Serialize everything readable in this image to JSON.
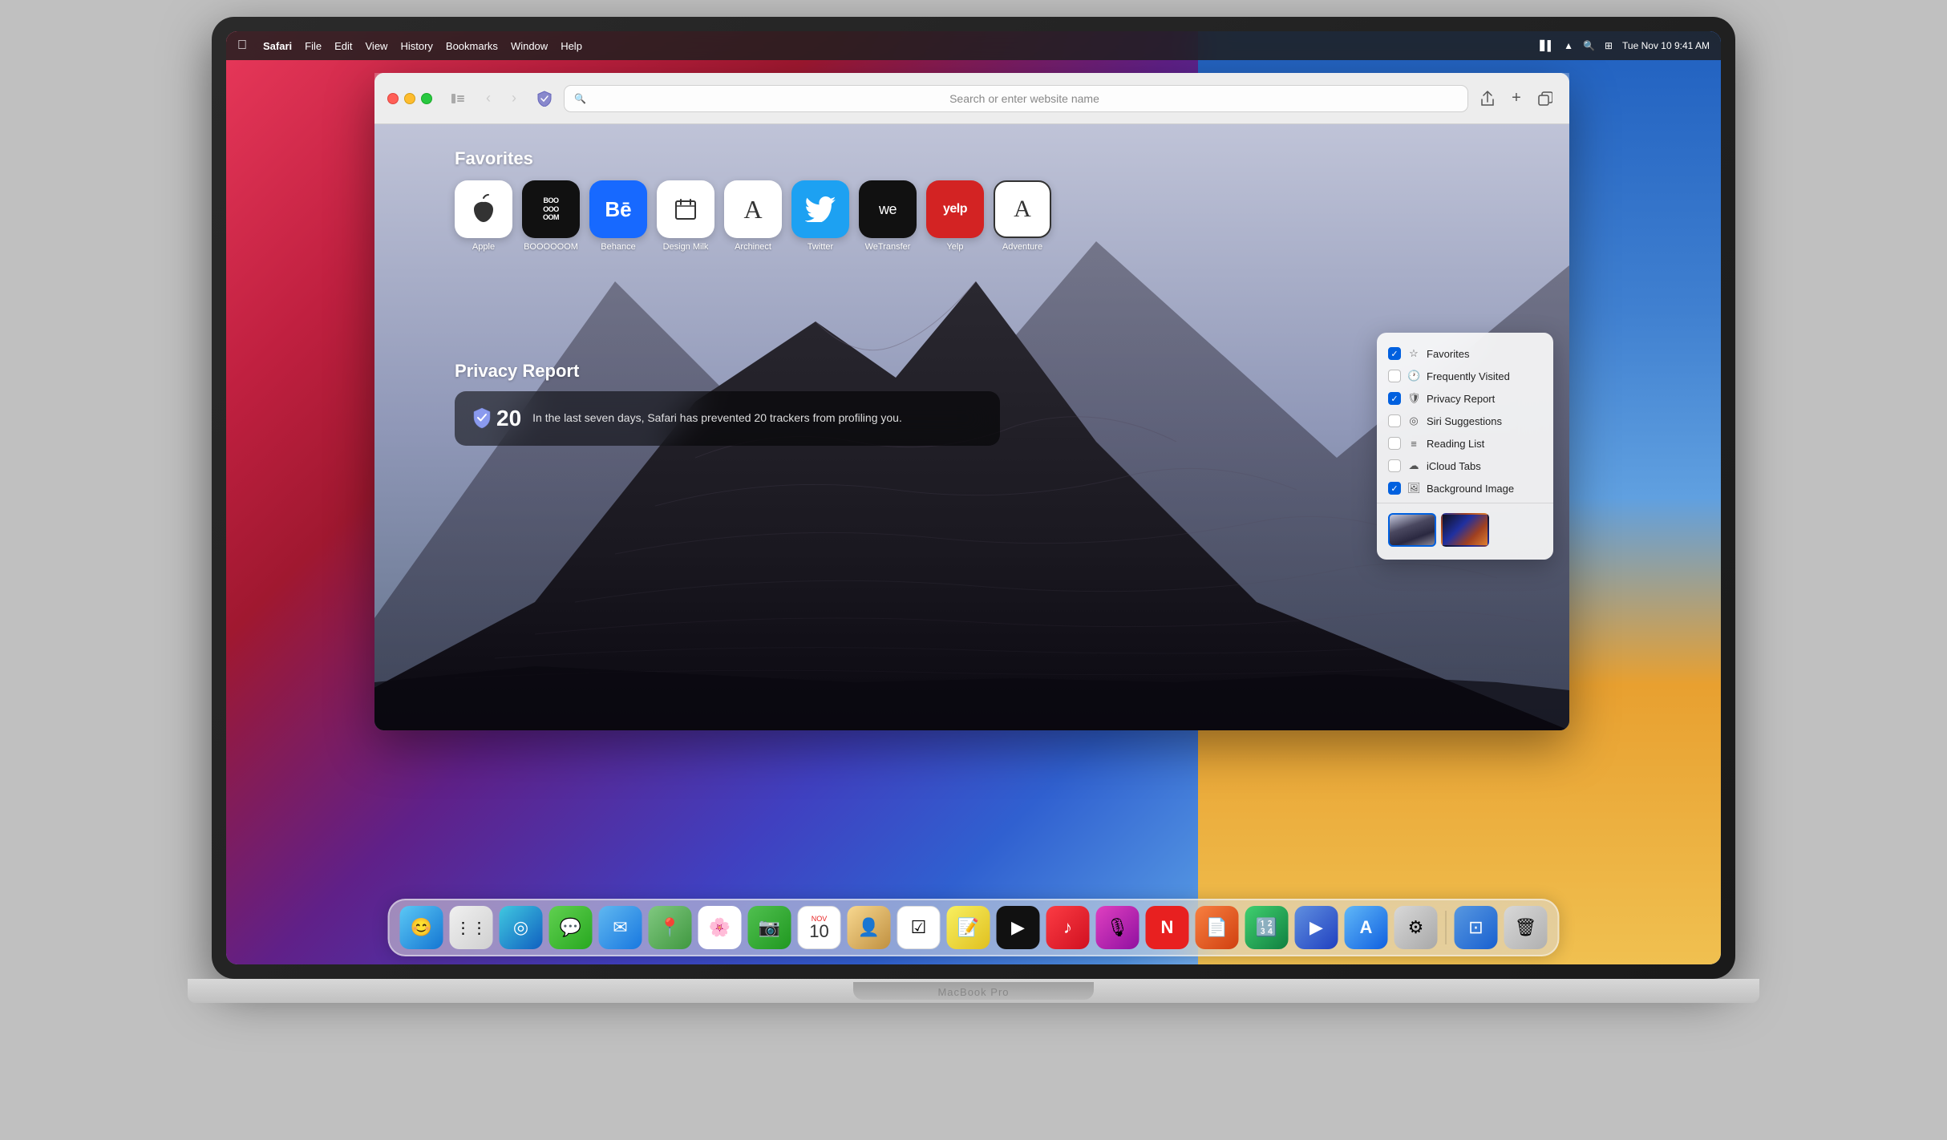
{
  "menubar": {
    "apple_label": "",
    "app_name": "Safari",
    "menus": [
      "File",
      "Edit",
      "View",
      "History",
      "Bookmarks",
      "Window",
      "Help"
    ],
    "time": "Tue Nov 10  9:41 AM"
  },
  "safari": {
    "address_placeholder": "Search or enter website name",
    "toolbar_buttons": {
      "share": "⬆",
      "new_tab": "+",
      "tabs": "⧉"
    }
  },
  "favorites": {
    "title": "Favorites",
    "items": [
      {
        "label": "Apple",
        "bg": "apple",
        "symbol": ""
      },
      {
        "label": "BOOOOOOM",
        "bg": "boooooom",
        "symbol": "BOO\nOOO\nOOM"
      },
      {
        "label": "Behance",
        "bg": "behance",
        "symbol": "Bē"
      },
      {
        "label": "Design Milk",
        "bg": "designmilk",
        "symbol": "🥛"
      },
      {
        "label": "Archinect",
        "bg": "archinect",
        "symbol": "A"
      },
      {
        "label": "Twitter",
        "bg": "twitter",
        "symbol": "🐦"
      },
      {
        "label": "WeTransfer",
        "bg": "wetransfer",
        "symbol": "we"
      },
      {
        "label": "Yelp",
        "bg": "yelp",
        "symbol": "yelp"
      },
      {
        "label": "Adventure",
        "bg": "adventure",
        "symbol": "A"
      }
    ]
  },
  "privacy_report": {
    "title": "Privacy Report",
    "count": "20",
    "text": "In the last seven days, Safari has prevented 20 trackers from profiling you."
  },
  "customize_panel": {
    "items": [
      {
        "id": "favorites",
        "label": "Favorites",
        "checked": true,
        "icon": "☆"
      },
      {
        "id": "frequently_visited",
        "label": "Frequently Visited",
        "checked": false,
        "icon": "🕐"
      },
      {
        "id": "privacy_report",
        "label": "Privacy Report",
        "checked": true,
        "icon": "🛡"
      },
      {
        "id": "siri_suggestions",
        "label": "Siri Suggestions",
        "checked": false,
        "icon": "⟳"
      },
      {
        "id": "reading_list",
        "label": "Reading List",
        "checked": false,
        "icon": "☁"
      },
      {
        "id": "icloud_tabs",
        "label": "iCloud Tabs",
        "checked": false,
        "icon": "☁"
      },
      {
        "id": "background_image",
        "label": "Background Image",
        "checked": true,
        "icon": "🖼"
      }
    ]
  },
  "dock": {
    "macbook_label": "MacBook Pro",
    "apps": [
      {
        "id": "finder",
        "label": "Finder",
        "symbol": "😊",
        "class": "dock-finder"
      },
      {
        "id": "launchpad",
        "label": "Launchpad",
        "symbol": "⋯",
        "class": "dock-launchpad"
      },
      {
        "id": "safari",
        "label": "Safari",
        "symbol": "◎",
        "class": "dock-safari"
      },
      {
        "id": "messages",
        "label": "Messages",
        "symbol": "💬",
        "class": "dock-messages"
      },
      {
        "id": "mail",
        "label": "Mail",
        "symbol": "✉",
        "class": "dock-mail"
      },
      {
        "id": "maps",
        "label": "Maps",
        "symbol": "📍",
        "class": "dock-maps"
      },
      {
        "id": "photos",
        "label": "Photos",
        "symbol": "🌸",
        "class": "dock-photos"
      },
      {
        "id": "facetime",
        "label": "FaceTime",
        "symbol": "📷",
        "class": "dock-facetime"
      },
      {
        "id": "calendar",
        "label": "Calendar",
        "symbol": "10",
        "class": "dock-calendar"
      },
      {
        "id": "contacts",
        "label": "Contacts",
        "symbol": "👤",
        "class": "dock-contacts"
      },
      {
        "id": "reminders",
        "label": "Reminders",
        "symbol": "☑",
        "class": "dock-reminders"
      },
      {
        "id": "notes",
        "label": "Notes",
        "symbol": "📝",
        "class": "dock-notes"
      },
      {
        "id": "appletv",
        "label": "Apple TV",
        "symbol": "▶",
        "class": "dock-appletv"
      },
      {
        "id": "music",
        "label": "Music",
        "symbol": "♪",
        "class": "dock-music"
      },
      {
        "id": "podcasts",
        "label": "Podcasts",
        "symbol": "🎙",
        "class": "dock-podcasts"
      },
      {
        "id": "news",
        "label": "News",
        "symbol": "N",
        "class": "dock-news"
      },
      {
        "id": "pages",
        "label": "Pages",
        "symbol": "📄",
        "class": "dock-pages"
      },
      {
        "id": "numbers",
        "label": "Numbers",
        "symbol": "🔢",
        "class": "dock-numbers"
      },
      {
        "id": "keynote",
        "label": "Keynote",
        "symbol": "▶",
        "class": "dock-keynote"
      },
      {
        "id": "appstore",
        "label": "App Store",
        "symbol": "A",
        "class": "dock-appstore"
      },
      {
        "id": "systemprefs",
        "label": "System Preferences",
        "symbol": "⚙",
        "class": "dock-systemprefs"
      },
      {
        "id": "airplay",
        "label": "AirPlay",
        "symbol": "⊡",
        "class": "dock-airplay"
      },
      {
        "id": "trash",
        "label": "Trash",
        "symbol": "🗑",
        "class": "dock-trash"
      }
    ]
  }
}
